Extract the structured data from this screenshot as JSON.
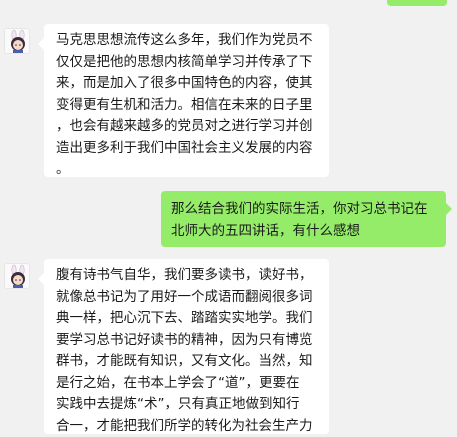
{
  "messages": [
    {
      "sender": "other",
      "text": "马克思思想流传这么多年，我们作为党员不\n仅仅是把他的思想内核简单学习并传承了下\n来，而是加入了很多中国特色的内容，使其\n变得更有生机和活力。相信在未来的日子里\n，也会有越来越多的党员对之进行学习并创\n造出更多利于我们中国社会主义发展的内容\n。"
    },
    {
      "sender": "self",
      "text": "那么结合我们的实际生活，你对习总书记在\n北师大的五四讲话，有什么感想"
    },
    {
      "sender": "other",
      "text": "腹有诗书气自华，我们要多读书，读好书，\n就像总书记为了用好一个成语而翻阅很多词\n典一样，把心沉下去、踏踏实实地学。我们\n要学习总书记好读书的精神，因为只有博览\n群书，才能既有知识，又有文化。当然，知\n是行之始，在书本上学会了“道”，更要在\n实践中去提炼“术”，只有真正地做到知行\n合一，才能把我们所学的转化为社会生产力"
    }
  ],
  "colors": {
    "background": "#f1f1f1",
    "self_bubble": "#95ec69",
    "other_bubble": "#ffffff"
  }
}
